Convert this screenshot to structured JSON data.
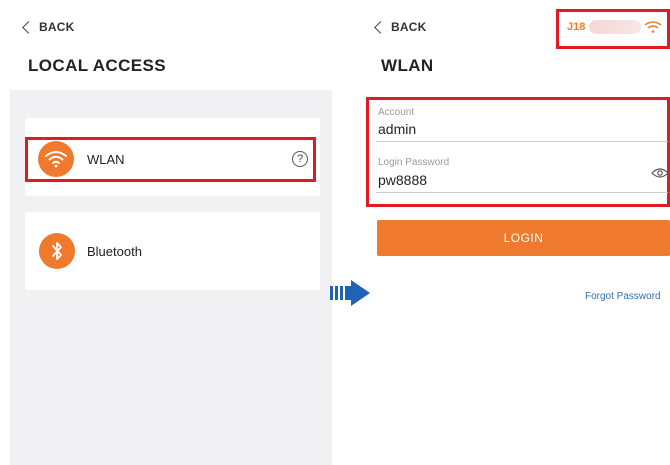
{
  "left": {
    "back_label": "BACK",
    "title": "LOCAL ACCESS",
    "items": [
      {
        "label": "WLAN",
        "icon": "wifi-icon"
      },
      {
        "label": "Bluetooth",
        "icon": "bluetooth-icon"
      }
    ],
    "help_glyph": "?"
  },
  "right": {
    "back_label": "BACK",
    "title": "WLAN",
    "ssid_prefix": "J18",
    "account_label": "Account",
    "account_value": "admin",
    "password_label": "Login Password",
    "password_value": "pw8888",
    "login_label": "LOGIN",
    "forgot_label": "Forgot Password"
  },
  "colors": {
    "accent": "#ef7a2e",
    "highlight": "#e11b22",
    "link": "#2f6fb5",
    "arrow": "#1f63b5"
  }
}
